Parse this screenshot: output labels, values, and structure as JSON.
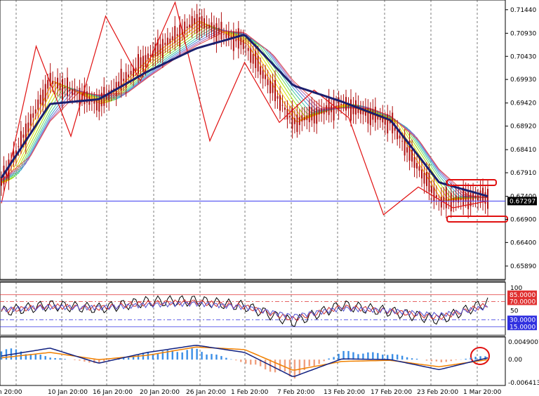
{
  "chart_data": [
    {
      "type": "line",
      "panel": "price",
      "ylim": [
        0.656,
        0.7165
      ],
      "y_ticks": [
        "0.71440",
        "0.70930",
        "0.70430",
        "0.69930",
        "0.69420",
        "0.68920",
        "0.68410",
        "0.67910",
        "0.67400",
        "0.66900",
        "0.66400",
        "0.65890"
      ],
      "current_price_label": "0.67297",
      "current_price": 0.67297,
      "colors": {
        "candles": "#b01010",
        "zigzag": "#e01010",
        "slow_ma": "#1a1f6e",
        "current_line": "#3a3af0",
        "fan": [
          "#ffbf00",
          "#f5d000",
          "#d6de00",
          "#a8e000",
          "#73d860",
          "#40c8a0",
          "#3aa0d0",
          "#7070d0",
          "#b060b0",
          "#e05050"
        ]
      },
      "x_labels": [
        "n 20:00",
        "10 Jan 20:00",
        "16 Jan 20:00",
        "20 Jan 20:00",
        "26 Jan 20:00",
        "1 Feb 20:00",
        "7 Feb 20:00",
        "13 Feb 20:00",
        "17 Feb 20:00",
        "23 Feb 20:00",
        "1 Mar 20:00"
      ],
      "x_index": [
        0,
        1,
        2,
        3,
        4,
        5,
        6,
        7,
        8,
        9,
        10
      ],
      "close": [
        0.677,
        0.699,
        0.694,
        0.704,
        0.712,
        0.707,
        0.69,
        0.694,
        0.69,
        0.673,
        0.674
      ],
      "slow_ma": [
        0.678,
        0.694,
        0.695,
        0.701,
        0.706,
        0.709,
        0.698,
        0.6945,
        0.6905,
        0.677,
        0.674
      ],
      "zigzag": [
        0.6725,
        0.7065,
        0.687,
        0.713,
        0.699,
        0.716,
        0.686,
        0.703,
        0.69,
        0.697,
        0.691,
        0.67,
        0.676,
        0.6715,
        0.673
      ],
      "series": []
    },
    {
      "type": "line",
      "panel": "oscillator",
      "ylim": [
        0,
        100
      ],
      "levels": [
        {
          "label": "85.0000",
          "value": 85,
          "color": "#e03030"
        },
        {
          "label": "70.0000",
          "value": 70,
          "color": "#e03030"
        },
        {
          "label": "30.0000",
          "value": 30,
          "color": "#3030e0"
        },
        {
          "label": "15.0000",
          "value": 15,
          "color": "#3030e0"
        }
      ],
      "y_ticks": [
        "100",
        "50"
      ],
      "colors": {
        "fast": "#000000",
        "mid": "#d03030",
        "slow": "#5050d0"
      },
      "fast": [
        48,
        62,
        55,
        70,
        72,
        60,
        25,
        62,
        48,
        30,
        68
      ],
      "slow": [
        52,
        58,
        57,
        63,
        66,
        58,
        38,
        55,
        50,
        40,
        58
      ],
      "series": []
    },
    {
      "type": "bar",
      "panel": "macd",
      "ylim": [
        -0.006413,
        0.0055
      ],
      "y_ticks": [
        "0.0049007",
        "0.00",
        "-0.006413"
      ],
      "colors": {
        "up": "#3a8ee6",
        "down": "#f0a080",
        "signal": "#f08000",
        "main": "#102080",
        "highlight": "#e01010"
      },
      "histogram": [
        0.0038,
        0.0008,
        -0.0012,
        0.0022,
        0.0032,
        -0.001,
        -0.0055,
        0.0025,
        0.0018,
        -0.001,
        0.0014
      ],
      "main": [
        0.001,
        0.0032,
        -0.001,
        0.002,
        0.004,
        0.002,
        -0.0048,
        0.0002,
        0.0,
        -0.0028,
        0.0005
      ],
      "signal": [
        0.0005,
        0.002,
        0.0,
        0.0012,
        0.0035,
        0.0028,
        -0.003,
        -0.0005,
        -0.0002,
        -0.002,
        0.0
      ],
      "series": []
    }
  ]
}
